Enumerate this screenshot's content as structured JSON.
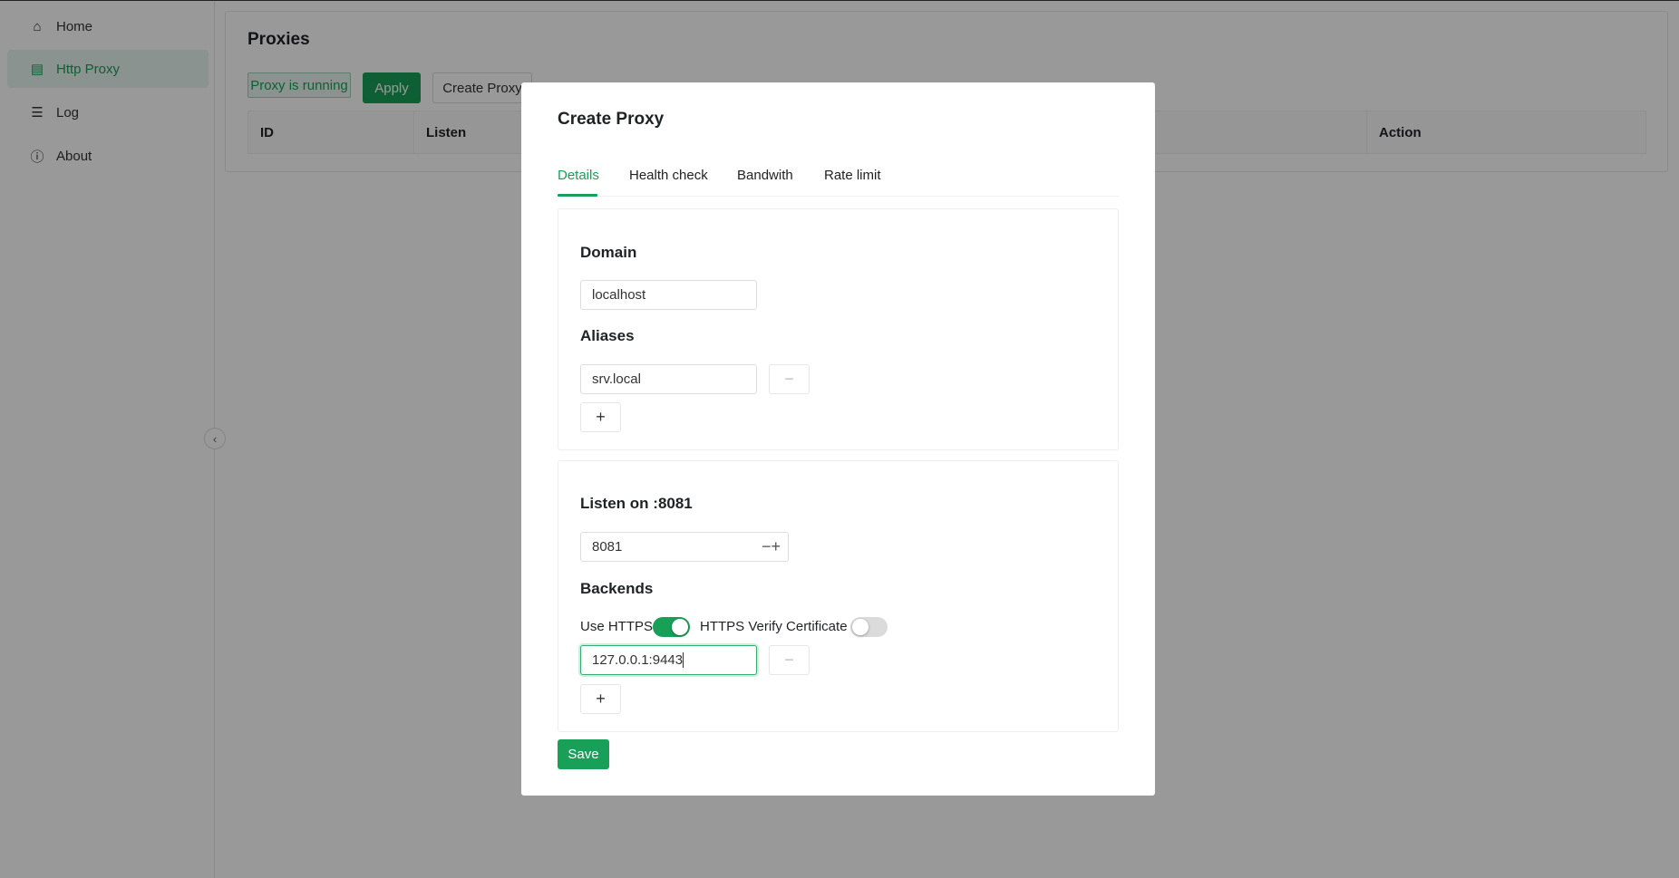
{
  "sidebar": {
    "items": [
      {
        "label": "Home",
        "icon": "home-icon"
      },
      {
        "label": "Http Proxy",
        "icon": "proxy-icon",
        "active": true
      },
      {
        "label": "Log",
        "icon": "list-icon"
      },
      {
        "label": "About",
        "icon": "info-icon"
      }
    ]
  },
  "page": {
    "title": "Proxies",
    "status": "Proxy is running",
    "apply": "Apply",
    "create": "Create Proxy",
    "columns": [
      "ID",
      "Listen",
      "Action"
    ]
  },
  "modal": {
    "title": "Create Proxy",
    "tabs": [
      "Details",
      "Health check",
      "Bandwith",
      "Rate limit"
    ],
    "domain_label": "Domain",
    "domain_value": "localhost",
    "aliases_label": "Aliases",
    "aliases": [
      "srv.local"
    ],
    "listen_label": "Listen on :8081",
    "listen_value": "8081",
    "backends_label": "Backends",
    "use_https_label": "Use HTTPS",
    "use_https": true,
    "verify_label": "HTTPS Verify Certificate",
    "verify": false,
    "backends": [
      "127.0.0.1:9443"
    ],
    "save": "Save"
  },
  "colors": {
    "accent": "#18a058"
  }
}
